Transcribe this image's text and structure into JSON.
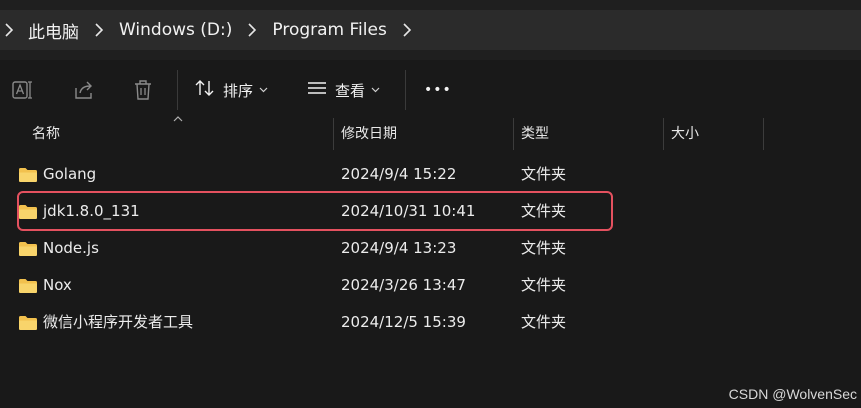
{
  "breadcrumb": {
    "items": [
      {
        "label": "此电脑"
      },
      {
        "label": "Windows (D:)"
      },
      {
        "label": "Program Files"
      }
    ]
  },
  "toolbar": {
    "sort_label": "排序",
    "view_label": "查看",
    "more_label": "•••",
    "icons": {
      "rename": "rename-icon",
      "share": "share-icon",
      "delete": "delete-icon",
      "sort": "sort-icon",
      "view": "view-icon"
    }
  },
  "columns": {
    "name": "名称",
    "modified": "修改日期",
    "type": "类型",
    "size": "大小"
  },
  "files": [
    {
      "name": "Golang",
      "modified": "2024/9/4 15:22",
      "type": "文件夹"
    },
    {
      "name": "jdk1.8.0_131",
      "modified": "2024/10/31 10:41",
      "type": "文件夹",
      "highlighted": true
    },
    {
      "name": "Node.js",
      "modified": "2024/9/4 13:23",
      "type": "文件夹"
    },
    {
      "name": "Nox",
      "modified": "2024/3/26 13:47",
      "type": "文件夹"
    },
    {
      "name": "微信小程序开发者工具",
      "modified": "2024/12/5 15:39",
      "type": "文件夹"
    }
  ],
  "watermark": "CSDN @WolvenSec",
  "colors": {
    "folder": "#f2c14e",
    "highlight_border": "#e4515f",
    "background": "#191919"
  }
}
